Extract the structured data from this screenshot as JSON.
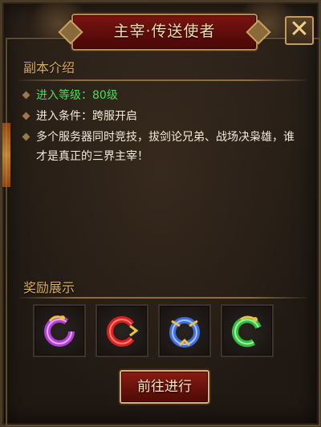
{
  "window": {
    "title": "主宰·传送使者",
    "close_label": "✕"
  },
  "intro": {
    "heading": "副本介绍",
    "items": [
      {
        "text": "进入等级：80级",
        "color": "#3ee05a"
      },
      {
        "text": "进入条件：跨服开启",
        "color": "#f2ead8"
      },
      {
        "text": "多个服务器同时竞技，拔剑论兄弟、战场决枭雄，谁才是真正的三界主宰！",
        "color": "#f2ead8"
      }
    ]
  },
  "rewards": {
    "heading": "奖励展示",
    "items": [
      {
        "icon": "purple-dragon-ring-icon",
        "colors": [
          "#b040d8",
          "#f0c040"
        ]
      },
      {
        "icon": "red-dragon-ring-icon",
        "colors": [
          "#e02020",
          "#f0c040"
        ]
      },
      {
        "icon": "blue-dragon-ring-icon",
        "colors": [
          "#4070e0",
          "#f0c040"
        ]
      },
      {
        "icon": "green-dragon-ring-icon",
        "colors": [
          "#30c040",
          "#f0c040"
        ]
      }
    ]
  },
  "actions": {
    "go_label": "前往进行"
  },
  "colors": {
    "accent_gold": "#d8ad60",
    "title_red": "#7a1411",
    "level_green": "#3ee05a"
  }
}
